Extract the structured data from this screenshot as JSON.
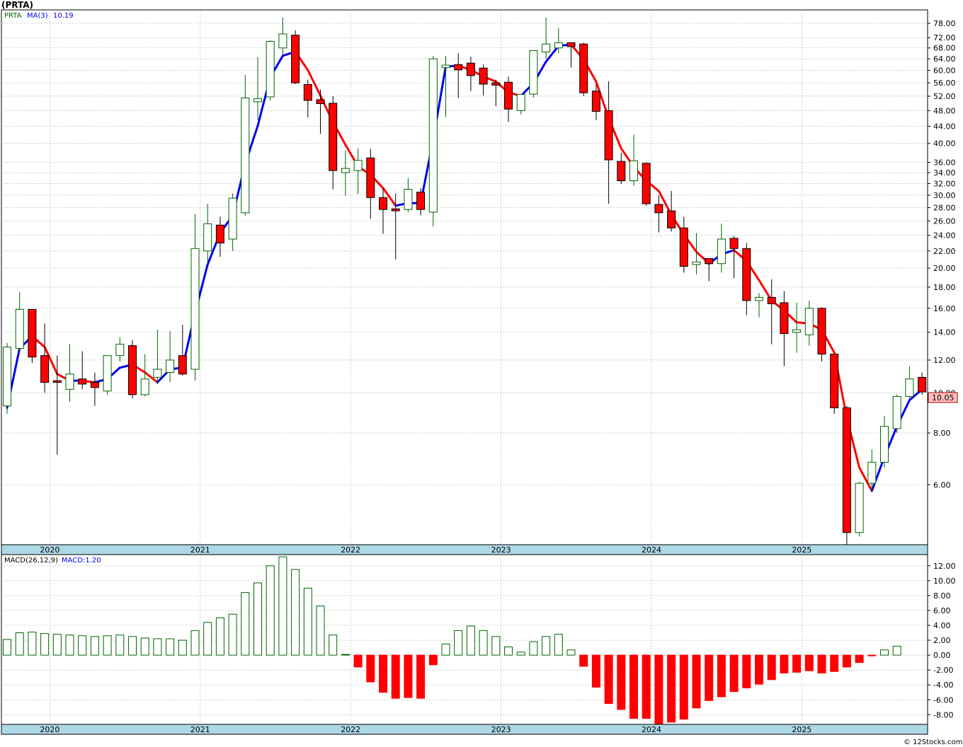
{
  "title": "(PRTA)",
  "watermark": "© 12Stocks.com",
  "colors": {
    "up_candle": "#006400",
    "down_candle": "#ff0000",
    "ma_up": "#0000ee",
    "ma_down": "#ff0000",
    "macd_pos": "#006400",
    "macd_neg": "#ff0000",
    "axis_band": "#add8e6",
    "grid": "#b0b0b0",
    "price_tag_bg": "#ffc0c0",
    "price_tag_text": "#b00000"
  },
  "chart_data": [
    {
      "type": "candlestick",
      "panel": "price",
      "legend": {
        "symbol": "PRTA",
        "ma_label": "MA(3)",
        "ma_value": "10.19"
      },
      "y_scale": "log",
      "ylim": [
        4.3,
        84
      ],
      "y_ticks": [
        6,
        8,
        10,
        12,
        14,
        16,
        18,
        20,
        22,
        24,
        26,
        28,
        30,
        32,
        34,
        36,
        40,
        44,
        48,
        52,
        56,
        60,
        64,
        68,
        72,
        78
      ],
      "y_tick_labels": [
        "6.00",
        "8.00",
        "10.00",
        "12.00",
        "14.00",
        "16.00",
        "18.00",
        "20.00",
        "22.00",
        "24.00",
        "26.00",
        "28.00",
        "30.00",
        "32.00",
        "34.00",
        "36.00",
        "40.00",
        "44.00",
        "48.00",
        "52.00",
        "56.00",
        "60.00",
        "64.00",
        "68.00",
        "72.00",
        "78.00"
      ],
      "x_year_labels": [
        "2020",
        "2021",
        "2022",
        "2023",
        "2024",
        "2025"
      ],
      "x_year_start_index": [
        2,
        14,
        26,
        38,
        50,
        62
      ],
      "last_price_label": "10.05",
      "last_price": 10.05,
      "candles": [
        {
          "o": 9.3,
          "h": 13.2,
          "l": 8.9,
          "c": 12.9
        },
        {
          "o": 12.8,
          "h": 17.5,
          "l": 12.6,
          "c": 15.9
        },
        {
          "o": 15.9,
          "h": 15.9,
          "l": 11.8,
          "c": 12.2
        },
        {
          "o": 12.3,
          "h": 14.7,
          "l": 10.0,
          "c": 10.6
        },
        {
          "o": 10.7,
          "h": 12.3,
          "l": 7.1,
          "c": 10.6
        },
        {
          "o": 10.2,
          "h": 13.1,
          "l": 9.5,
          "c": 11.1
        },
        {
          "o": 10.8,
          "h": 12.6,
          "l": 10.2,
          "c": 10.5
        },
        {
          "o": 10.6,
          "h": 11.2,
          "l": 9.3,
          "c": 10.3
        },
        {
          "o": 10.1,
          "h": 12.1,
          "l": 9.9,
          "c": 12.3
        },
        {
          "o": 12.3,
          "h": 13.6,
          "l": 11.9,
          "c": 13.1
        },
        {
          "o": 13.0,
          "h": 13.4,
          "l": 9.7,
          "c": 9.9
        },
        {
          "o": 9.9,
          "h": 12.4,
          "l": 9.8,
          "c": 10.8
        },
        {
          "o": 10.9,
          "h": 14.2,
          "l": 10.5,
          "c": 11.4
        },
        {
          "o": 11.2,
          "h": 14.1,
          "l": 10.6,
          "c": 12.0
        },
        {
          "o": 12.3,
          "h": 14.6,
          "l": 11.0,
          "c": 11.1
        },
        {
          "o": 11.4,
          "h": 27.0,
          "l": 10.7,
          "c": 22.3
        },
        {
          "o": 22.0,
          "h": 28.6,
          "l": 20.5,
          "c": 25.6
        },
        {
          "o": 25.4,
          "h": 26.6,
          "l": 21.3,
          "c": 23.0
        },
        {
          "o": 23.5,
          "h": 30.3,
          "l": 22.0,
          "c": 29.5
        },
        {
          "o": 27.2,
          "h": 58.5,
          "l": 26.8,
          "c": 51.5
        },
        {
          "o": 50.4,
          "h": 64.6,
          "l": 45.6,
          "c": 51.3
        },
        {
          "o": 51.8,
          "h": 71.0,
          "l": 50.8,
          "c": 70.5
        },
        {
          "o": 68.0,
          "h": 80.5,
          "l": 65.5,
          "c": 73.5
        },
        {
          "o": 73.0,
          "h": 75.0,
          "l": 55.6,
          "c": 56.0
        },
        {
          "o": 55.5,
          "h": 57.0,
          "l": 46.2,
          "c": 50.8
        },
        {
          "o": 51.0,
          "h": 54.0,
          "l": 42.2,
          "c": 49.9
        },
        {
          "o": 50.0,
          "h": 52.0,
          "l": 31.0,
          "c": 34.4
        },
        {
          "o": 34.0,
          "h": 38.5,
          "l": 29.9,
          "c": 34.8
        },
        {
          "o": 34.4,
          "h": 38.9,
          "l": 30.2,
          "c": 36.4
        },
        {
          "o": 36.9,
          "h": 38.8,
          "l": 26.3,
          "c": 29.6
        },
        {
          "o": 29.6,
          "h": 31.2,
          "l": 24.2,
          "c": 27.7
        },
        {
          "o": 27.8,
          "h": 30.3,
          "l": 21.0,
          "c": 27.5
        },
        {
          "o": 27.7,
          "h": 33.0,
          "l": 27.3,
          "c": 31.0
        },
        {
          "o": 30.5,
          "h": 31.2,
          "l": 26.8,
          "c": 27.7
        },
        {
          "o": 27.3,
          "h": 65.0,
          "l": 25.2,
          "c": 64.0
        },
        {
          "o": 61.0,
          "h": 65.0,
          "l": 46.3,
          "c": 61.8
        },
        {
          "o": 62.0,
          "h": 66.0,
          "l": 51.5,
          "c": 60.2
        },
        {
          "o": 62.5,
          "h": 64.8,
          "l": 53.5,
          "c": 58.3
        },
        {
          "o": 60.8,
          "h": 62.0,
          "l": 52.2,
          "c": 55.6
        },
        {
          "o": 56.0,
          "h": 57.0,
          "l": 49.2,
          "c": 55.3
        },
        {
          "o": 56.2,
          "h": 58.0,
          "l": 45.1,
          "c": 48.4
        },
        {
          "o": 48.0,
          "h": 52.2,
          "l": 47.0,
          "c": 52.5
        },
        {
          "o": 52.6,
          "h": 56.7,
          "l": 51.6,
          "c": 67.0
        },
        {
          "o": 66.5,
          "h": 80.5,
          "l": 64.0,
          "c": 69.5
        },
        {
          "o": 68.0,
          "h": 76.0,
          "l": 66.0,
          "c": 70.0
        },
        {
          "o": 70.0,
          "h": 70.0,
          "l": 61.0,
          "c": 68.5
        },
        {
          "o": 69.5,
          "h": 70.0,
          "l": 52.0,
          "c": 53.0
        },
        {
          "o": 53.5,
          "h": 55.5,
          "l": 45.5,
          "c": 47.8
        },
        {
          "o": 48.0,
          "h": 56.5,
          "l": 28.6,
          "c": 36.5
        },
        {
          "o": 36.2,
          "h": 38.0,
          "l": 31.9,
          "c": 32.5
        },
        {
          "o": 32.5,
          "h": 42.0,
          "l": 31.6,
          "c": 36.3
        },
        {
          "o": 35.8,
          "h": 36.0,
          "l": 28.3,
          "c": 28.6
        },
        {
          "o": 28.5,
          "h": 30.0,
          "l": 24.4,
          "c": 27.2
        },
        {
          "o": 27.5,
          "h": 30.7,
          "l": 24.5,
          "c": 25.0
        },
        {
          "o": 25.0,
          "h": 26.6,
          "l": 19.5,
          "c": 20.2
        },
        {
          "o": 20.4,
          "h": 24.3,
          "l": 19.3,
          "c": 20.7
        },
        {
          "o": 21.1,
          "h": 21.1,
          "l": 18.6,
          "c": 20.5
        },
        {
          "o": 20.5,
          "h": 25.6,
          "l": 19.5,
          "c": 23.5
        },
        {
          "o": 23.6,
          "h": 23.9,
          "l": 18.9,
          "c": 22.3
        },
        {
          "o": 22.3,
          "h": 23.0,
          "l": 15.4,
          "c": 16.7
        },
        {
          "o": 16.7,
          "h": 17.4,
          "l": 15.2,
          "c": 17.0
        },
        {
          "o": 17.0,
          "h": 18.8,
          "l": 13.1,
          "c": 16.4
        },
        {
          "o": 16.5,
          "h": 17.6,
          "l": 11.6,
          "c": 13.9
        },
        {
          "o": 14.0,
          "h": 16.5,
          "l": 12.5,
          "c": 14.2
        },
        {
          "o": 13.8,
          "h": 16.7,
          "l": 13.0,
          "c": 16.0
        },
        {
          "o": 16.0,
          "h": 16.1,
          "l": 11.9,
          "c": 12.4
        },
        {
          "o": 12.4,
          "h": 12.4,
          "l": 8.9,
          "c": 9.2
        },
        {
          "o": 9.2,
          "h": 9.3,
          "l": 4.3,
          "c": 4.6
        },
        {
          "o": 4.6,
          "h": 6.1,
          "l": 4.5,
          "c": 6.05
        },
        {
          "o": 6.05,
          "h": 7.3,
          "l": 5.8,
          "c": 6.8
        },
        {
          "o": 6.8,
          "h": 8.8,
          "l": 6.6,
          "c": 8.3
        },
        {
          "o": 8.2,
          "h": 9.9,
          "l": 8.0,
          "c": 9.8
        },
        {
          "o": 9.8,
          "h": 11.6,
          "l": 9.7,
          "c": 10.8
        },
        {
          "o": 10.9,
          "h": 11.2,
          "l": 9.9,
          "c": 10.05
        }
      ],
      "ma3": [
        9.2,
        12.8,
        13.7,
        12.9,
        11.1,
        10.7,
        10.7,
        10.6,
        10.8,
        11.5,
        11.7,
        11.2,
        10.6,
        11.4,
        11.5,
        15.6,
        20.4,
        24.3,
        26.8,
        35.7,
        44.1,
        57.8,
        65.1,
        66.6,
        60.1,
        52.2,
        45.0,
        39.7,
        35.2,
        33.6,
        31.2,
        28.3,
        28.7,
        28.7,
        40.9,
        61.3,
        61.6,
        60.2,
        58.0,
        56.4,
        53.1,
        52.1,
        55.9,
        63.0,
        68.8,
        69.3,
        63.8,
        56.4,
        46.0,
        38.9,
        35.1,
        32.5,
        30.7,
        26.9,
        24.1,
        21.9,
        20.5,
        21.6,
        22.1,
        20.8,
        18.7,
        16.7,
        15.8,
        14.8,
        14.7,
        14.2,
        12.5,
        8.7,
        6.6,
        5.8,
        7.0,
        8.3,
        9.6,
        10.19
      ]
    },
    {
      "type": "bar",
      "panel": "macd",
      "legend": {
        "label": "MACD(26,12,9)",
        "value_label": "MACD:1.20"
      },
      "ylim": [
        -9.3,
        13.5
      ],
      "y_ticks": [
        -8,
        -6,
        -4,
        -2,
        0,
        2,
        4,
        6,
        8,
        10,
        12
      ],
      "y_tick_labels": [
        "-8.00",
        "-6.00",
        "-4.00",
        "-2.00",
        "0.00",
        "2.00",
        "4.00",
        "6.00",
        "8.00",
        "10.00",
        "12.00"
      ],
      "values": [
        2.1,
        3.0,
        3.1,
        2.9,
        2.8,
        2.7,
        2.6,
        2.5,
        2.6,
        2.7,
        2.5,
        2.3,
        2.2,
        2.2,
        2.0,
        3.3,
        4.4,
        5.0,
        5.5,
        8.4,
        9.7,
        12.0,
        13.2,
        11.5,
        9.0,
        6.6,
        2.7,
        0.0,
        -1.6,
        -3.6,
        -5.0,
        -5.8,
        -5.7,
        -5.8,
        -1.3,
        1.5,
        3.3,
        3.9,
        3.3,
        2.5,
        1.1,
        0.4,
        1.8,
        2.5,
        2.8,
        0.7,
        -1.5,
        -4.3,
        -6.5,
        -7.3,
        -8.5,
        -8.5,
        -9.2,
        -9.0,
        -8.6,
        -7.1,
        -6.1,
        -5.6,
        -4.9,
        -4.4,
        -3.9,
        -3.3,
        -2.4,
        -2.3,
        -2.1,
        -2.4,
        -2.2,
        -1.6,
        -1.0,
        -0.1,
        0.7,
        1.2
      ]
    }
  ]
}
